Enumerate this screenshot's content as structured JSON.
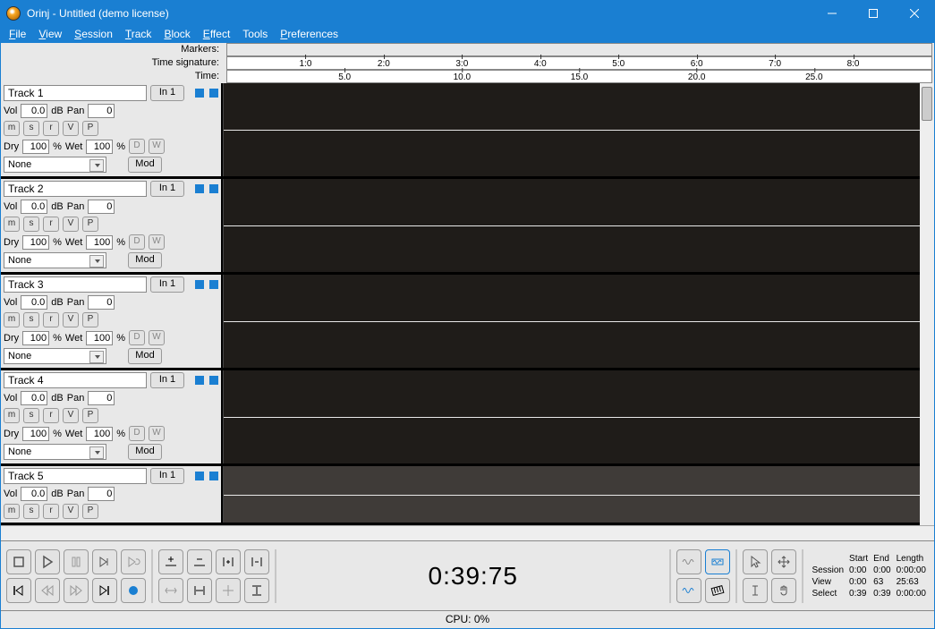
{
  "window": {
    "title": "Orinj - Untitled (demo license)"
  },
  "menubar": [
    "File",
    "View",
    "Session",
    "Track",
    "Block",
    "Effect",
    "Tools",
    "Preferences"
  ],
  "ruler_labels": {
    "markers": "Markers:",
    "timesig": "Time signature:",
    "time": "Time:"
  },
  "ruler_timesig": [
    "1:0",
    "2:0",
    "3:0",
    "4:0",
    "5:0",
    "6:0",
    "7:0",
    "8:0"
  ],
  "ruler_time": [
    "5.0",
    "10.0",
    "15.0",
    "20.0",
    "25.0"
  ],
  "track_defaults": {
    "input": "In 1",
    "vol_lbl": "Vol",
    "vol": "0.0",
    "db": "dB",
    "pan_lbl": "Pan",
    "pan": "0",
    "btns": [
      "m",
      "s",
      "r",
      "V",
      "P"
    ],
    "dry": "Dry",
    "dry_v": "100",
    "pct": "%",
    "wet": "Wet",
    "wet_v": "100",
    "d_btn": "D",
    "w_btn": "W",
    "effect": "None",
    "mod": "Mod"
  },
  "tracks": [
    {
      "name": "Track 1"
    },
    {
      "name": "Track 2"
    },
    {
      "name": "Track 3"
    },
    {
      "name": "Track 4"
    },
    {
      "name": "Track 5",
      "short": true,
      "lighter": true
    }
  ],
  "transport": {
    "time": "0:39:75"
  },
  "info": {
    "hdr": [
      "Start",
      "End",
      "Length"
    ],
    "rows": [
      [
        "Session",
        "0:00",
        "0:00",
        "0:00:00"
      ],
      [
        "View",
        "0:00",
        "63",
        "25:63"
      ],
      [
        "Select",
        "0:39",
        "0:39",
        "0:00:00"
      ]
    ]
  },
  "status": {
    "cpu": "CPU: 0%"
  }
}
